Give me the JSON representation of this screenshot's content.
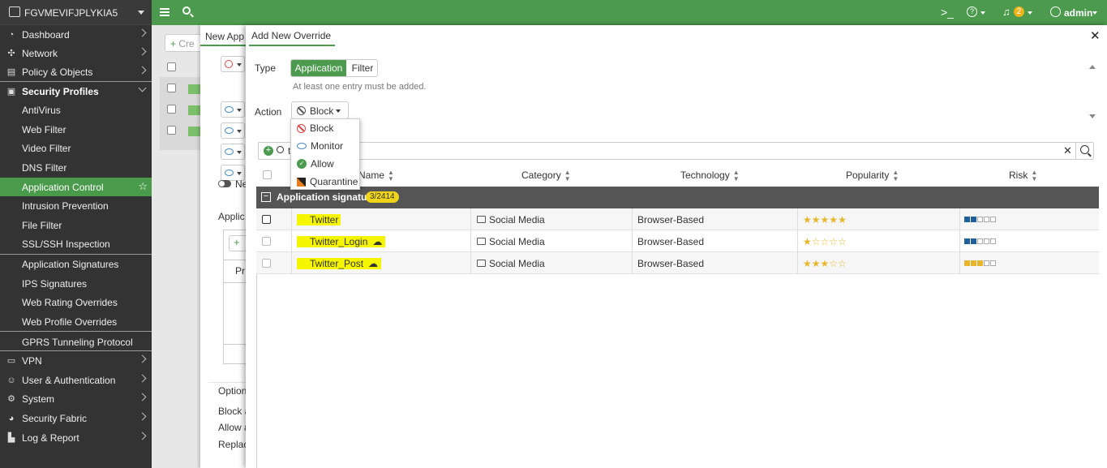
{
  "header": {
    "device_name": "FGVMEVIFJPLYKIA5",
    "user": "admin",
    "notification_count": "2"
  },
  "sidebar": {
    "items": [
      {
        "label": "Dashboard",
        "icon": "dashboard-icon"
      },
      {
        "label": "Network",
        "icon": "network-icon"
      },
      {
        "label": "Policy & Objects",
        "icon": "policy-icon"
      },
      {
        "label": "Security Profiles",
        "icon": "lock-icon"
      },
      {
        "label": "AntiVirus"
      },
      {
        "label": "Web Filter"
      },
      {
        "label": "Video Filter"
      },
      {
        "label": "DNS Filter"
      },
      {
        "label": "Application Control"
      },
      {
        "label": "Intrusion Prevention"
      },
      {
        "label": "File Filter"
      },
      {
        "label": "SSL/SSH Inspection"
      },
      {
        "label": "Application Signatures"
      },
      {
        "label": "IPS Signatures"
      },
      {
        "label": "Web Rating Overrides"
      },
      {
        "label": "Web Profile Overrides"
      },
      {
        "label": "GPRS Tunneling Protocol"
      },
      {
        "label": "VPN",
        "icon": "vpn-icon"
      },
      {
        "label": "User & Authentication",
        "icon": "user-icon"
      },
      {
        "label": "System",
        "icon": "gear-icon"
      },
      {
        "label": "Security Fabric",
        "icon": "fabric-icon"
      },
      {
        "label": "Log & Report",
        "icon": "chart-icon"
      }
    ]
  },
  "background_panel": {
    "create_label": "Cre",
    "tab_label": "New App",
    "ne_label": "Ne",
    "applic_label": "Applic",
    "pr_label": "Pr",
    "option_label": "Option",
    "block_label": "Block a",
    "allow_label": "Allow a",
    "replace_label": "Replac"
  },
  "override": {
    "title": "Add New Override",
    "type_label": "Type",
    "type_options": [
      "Application",
      "Filter"
    ],
    "type_selected": "Application",
    "hint": "At least one entry must be added.",
    "action_label": "Action",
    "action_selected": "Block",
    "action_options": [
      "Block",
      "Monitor",
      "Allow",
      "Quarantine"
    ],
    "search_value": "t",
    "columns": [
      "Name",
      "Category",
      "Technology",
      "Popularity",
      "Risk"
    ],
    "group_label": "Application signature",
    "group_count": "3/2414",
    "rows": [
      {
        "name": "Twitter",
        "category": "Social Media",
        "technology": "Browser-Based",
        "popularity": 5,
        "risk": 2,
        "risk_color": "#1f5f9a",
        "cloud": false
      },
      {
        "name": "Twitter_Login",
        "category": "Social Media",
        "technology": "Browser-Based",
        "popularity": 1,
        "risk": 2,
        "risk_color": "#1f5f9a",
        "cloud": true
      },
      {
        "name": "Twitter_Post",
        "category": "Social Media",
        "technology": "Browser-Based",
        "popularity": 3,
        "risk": 3,
        "risk_color": "#e8b62c",
        "cloud": true
      }
    ]
  },
  "colors": {
    "accent": "#4b9a4d",
    "sidebar": "#333333",
    "highlight": "#f5f500"
  }
}
